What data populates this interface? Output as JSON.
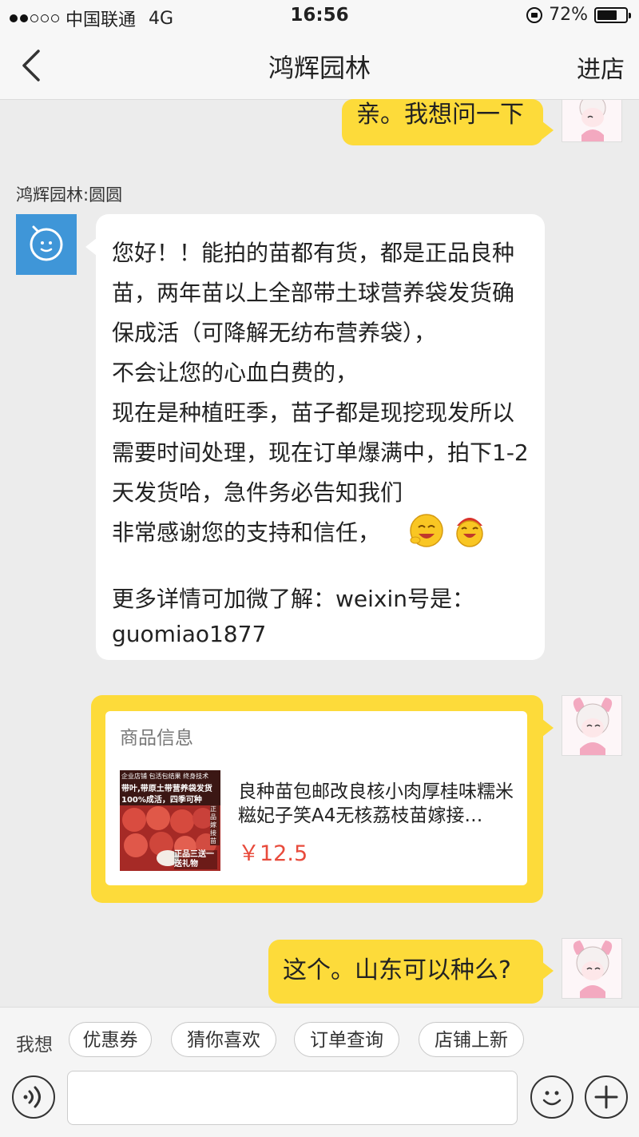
{
  "status_bar": {
    "carrier": "中国联通",
    "network": "4G",
    "time": "16:56",
    "battery": "72%",
    "battery_level": 0.72
  },
  "nav": {
    "title": "鸿辉园林",
    "enter_store": "进店"
  },
  "messages": {
    "m1": "亲。我想问一下",
    "sender": "鸿辉园林:圆圆",
    "m2": "您好！！能拍的苗都有货，都是正品良种苗，两年苗以上全部带土球营养袋发货确保成活（可降解无纺布营养袋），\n不会让您的心血白费的，\n现在是种植旺季，苗子都是现挖现发所以需要时间处理，现在订单爆满中，拍下1-2天发货哈，急件务必告知我们\n非常感谢您的支持和信任，",
    "m2_extra": "更多详情可加微了解：weixin号是：guomiao1877",
    "m3": "这个。山东可以种么?"
  },
  "product": {
    "header": "商品信息",
    "name": "良种苗包邮改良核小肉厚桂味糯米糍妃子笑A4无核荔枝苗嫁接…",
    "price": "￥12.5",
    "image_text": {
      "top": "企业店铺  包活包结果  终身技术",
      "line1": "带叶,带原土带营养袋发货",
      "line2": "100%成活，四季可种",
      "side": "正品 嫁接苗",
      "bottom": "正品三送一 送礼物"
    }
  },
  "quick_replies": {
    "label": "我想",
    "items": [
      "优惠券",
      "猜你喜欢",
      "订单查询",
      "店铺上新"
    ]
  },
  "input": {
    "placeholder": ""
  },
  "colors": {
    "bubble_user": "#fddb3a",
    "shop_avatar": "#3f96d8",
    "price": "#e84b3c"
  }
}
